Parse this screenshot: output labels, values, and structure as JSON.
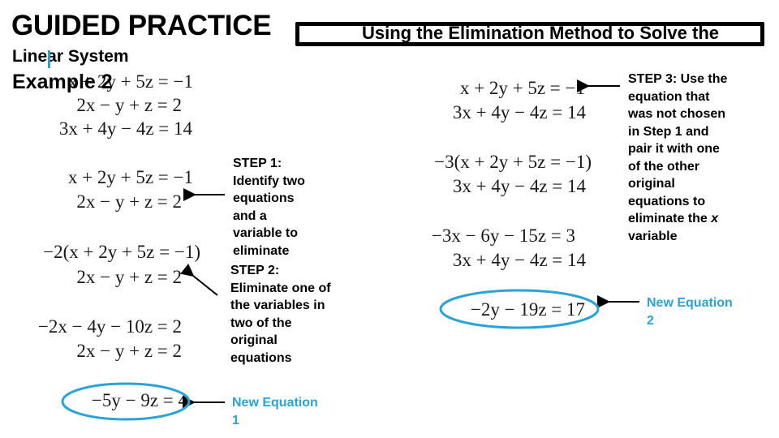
{
  "header": {
    "title": "GUIDED PRACTICE",
    "banner": "Using the Elimination Method to Solve the",
    "subtitle_line1": "Linear System",
    "subtitle_line2": "Example 2"
  },
  "system": {
    "eq1": "x + 2y + 5z = −1",
    "eq2": "2x − y + z = 2",
    "eq3": "3x + 4y − 4z = 14"
  },
  "step1": {
    "pair_a": "x + 2y + 5z = −1",
    "pair_b": "2x − y + z = 2",
    "text": "STEP 1:\nIdentify two\nequations\nand a\nvariable to\neliminate"
  },
  "step2": {
    "multiplied": "−2(x + 2y + 5z = −1)",
    "paired": "2x − y + z = 2",
    "expanded": "−2x − 4y − 10z = 2",
    "paired_again": "2x − y + z = 2",
    "result": "−5y − 9z = 4",
    "text": "STEP 2:\nEliminate one of\nthe variables in\ntwo of the\noriginal\nequations",
    "new_equation_label": "New Equation\n1"
  },
  "step3": {
    "pair_a": "x + 2y + 5z = −1",
    "pair_b": "3x + 4y − 4z = 14",
    "multiplied": "−3(x + 2y + 5z = −1)",
    "paired": "3x + 4y − 4z = 14",
    "expanded": "−3x − 6y − 15z = 3",
    "paired_again": "3x + 4y − 4z = 14",
    "result": "−2y − 19z = 17",
    "text_before_var": "STEP 3: Use the\nequation that\nwas not chosen\nin Step 1 and\npair it with one\nof the other\noriginal\nequations to\neliminate the ",
    "text_var": "x",
    "text_after_var": "\nvariable",
    "new_equation_label": "New Equation\n2"
  },
  "colors": {
    "accent": "#2aa3d6",
    "text": "#000000"
  }
}
